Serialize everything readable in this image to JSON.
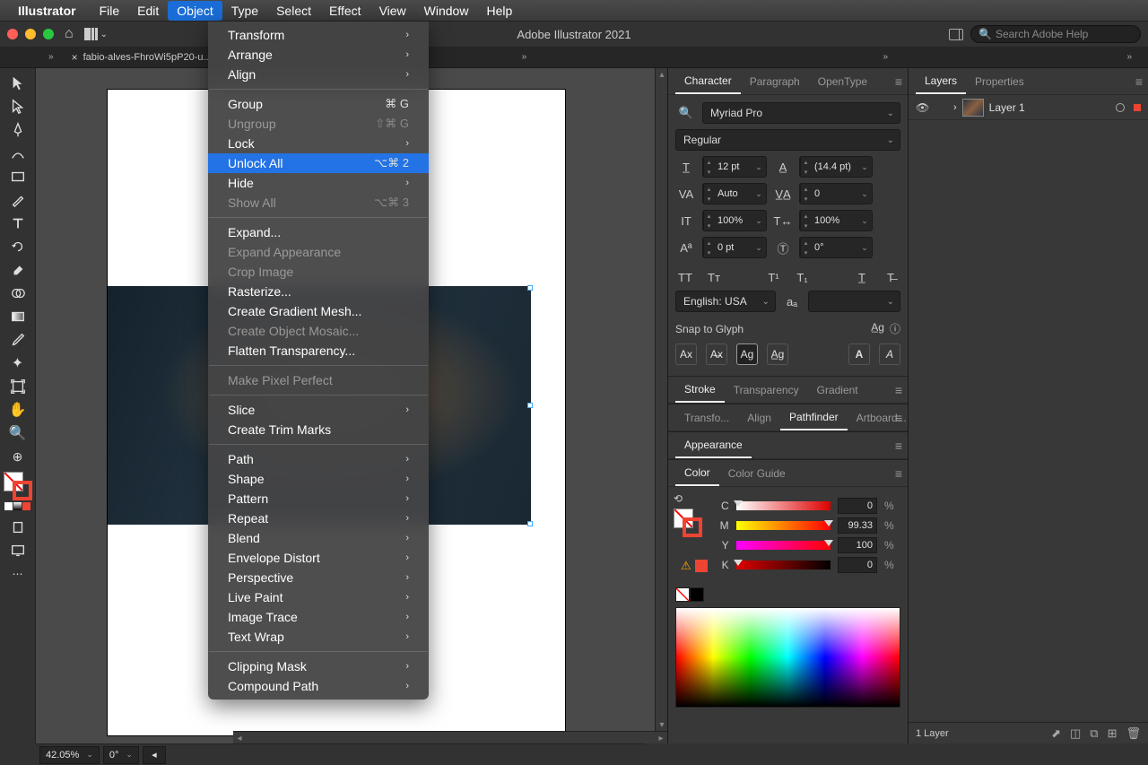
{
  "menubar": {
    "app_name": "Illustrator",
    "items": [
      "File",
      "Edit",
      "Object",
      "Type",
      "Select",
      "Effect",
      "View",
      "Window",
      "Help"
    ],
    "active_index": 2
  },
  "titlebar": {
    "title": "Adobe Illustrator 2021",
    "search_placeholder": "Search Adobe Help"
  },
  "tab": {
    "label": "fabio-alves-FhroWi5pP20-u..."
  },
  "dropdown": {
    "groups": [
      [
        {
          "label": "Transform",
          "submenu": true
        },
        {
          "label": "Arrange",
          "submenu": true
        },
        {
          "label": "Align",
          "submenu": true
        }
      ],
      [
        {
          "label": "Group",
          "shortcut": "⌘ G"
        },
        {
          "label": "Ungroup",
          "shortcut": "⇧⌘ G",
          "disabled": true
        },
        {
          "label": "Lock",
          "submenu": true
        },
        {
          "label": "Unlock All",
          "shortcut": "⌥⌘ 2",
          "highlighted": true
        },
        {
          "label": "Hide",
          "submenu": true
        },
        {
          "label": "Show All",
          "shortcut": "⌥⌘ 3",
          "disabled": true
        }
      ],
      [
        {
          "label": "Expand..."
        },
        {
          "label": "Expand Appearance",
          "disabled": true
        },
        {
          "label": "Crop Image",
          "disabled": true
        },
        {
          "label": "Rasterize..."
        },
        {
          "label": "Create Gradient Mesh..."
        },
        {
          "label": "Create Object Mosaic...",
          "disabled": true
        },
        {
          "label": "Flatten Transparency..."
        }
      ],
      [
        {
          "label": "Make Pixel Perfect",
          "disabled": true
        }
      ],
      [
        {
          "label": "Slice",
          "submenu": true
        },
        {
          "label": "Create Trim Marks"
        }
      ],
      [
        {
          "label": "Path",
          "submenu": true
        },
        {
          "label": "Shape",
          "submenu": true
        },
        {
          "label": "Pattern",
          "submenu": true
        },
        {
          "label": "Repeat",
          "submenu": true
        },
        {
          "label": "Blend",
          "submenu": true
        },
        {
          "label": "Envelope Distort",
          "submenu": true
        },
        {
          "label": "Perspective",
          "submenu": true
        },
        {
          "label": "Live Paint",
          "submenu": true
        },
        {
          "label": "Image Trace",
          "submenu": true
        },
        {
          "label": "Text Wrap",
          "submenu": true
        }
      ],
      [
        {
          "label": "Clipping Mask",
          "submenu": true
        },
        {
          "label": "Compound Path",
          "submenu": true
        }
      ]
    ]
  },
  "character": {
    "tabs": [
      "Character",
      "Paragraph",
      "OpenType"
    ],
    "font_family": "Myriad Pro",
    "font_style": "Regular",
    "size": "12 pt",
    "leading": "(14.4 pt)",
    "kerning": "Auto",
    "tracking": "0",
    "vscale": "100%",
    "hscale": "100%",
    "baseline": "0 pt",
    "rotation": "0°",
    "language": "English: USA",
    "snap_label": "Snap to Glyph"
  },
  "panel_row2": {
    "tabs": [
      "Stroke",
      "Transparency",
      "Gradient"
    ]
  },
  "panel_row3": {
    "tabs": [
      "Transfo...",
      "Align",
      "Pathfinder",
      "Artboard..."
    ]
  },
  "panel_row4": {
    "tabs": [
      "Appearance"
    ]
  },
  "color": {
    "tabs": [
      "Color",
      "Color Guide"
    ],
    "c": "0",
    "m": "99.33",
    "y": "100",
    "k": "0"
  },
  "layers": {
    "tabs": [
      "Layers",
      "Properties"
    ],
    "items": [
      {
        "name": "Layer 1"
      }
    ],
    "footer_label": "1 Layer"
  },
  "status": {
    "zoom": "42.05%",
    "rotate": "0°"
  }
}
